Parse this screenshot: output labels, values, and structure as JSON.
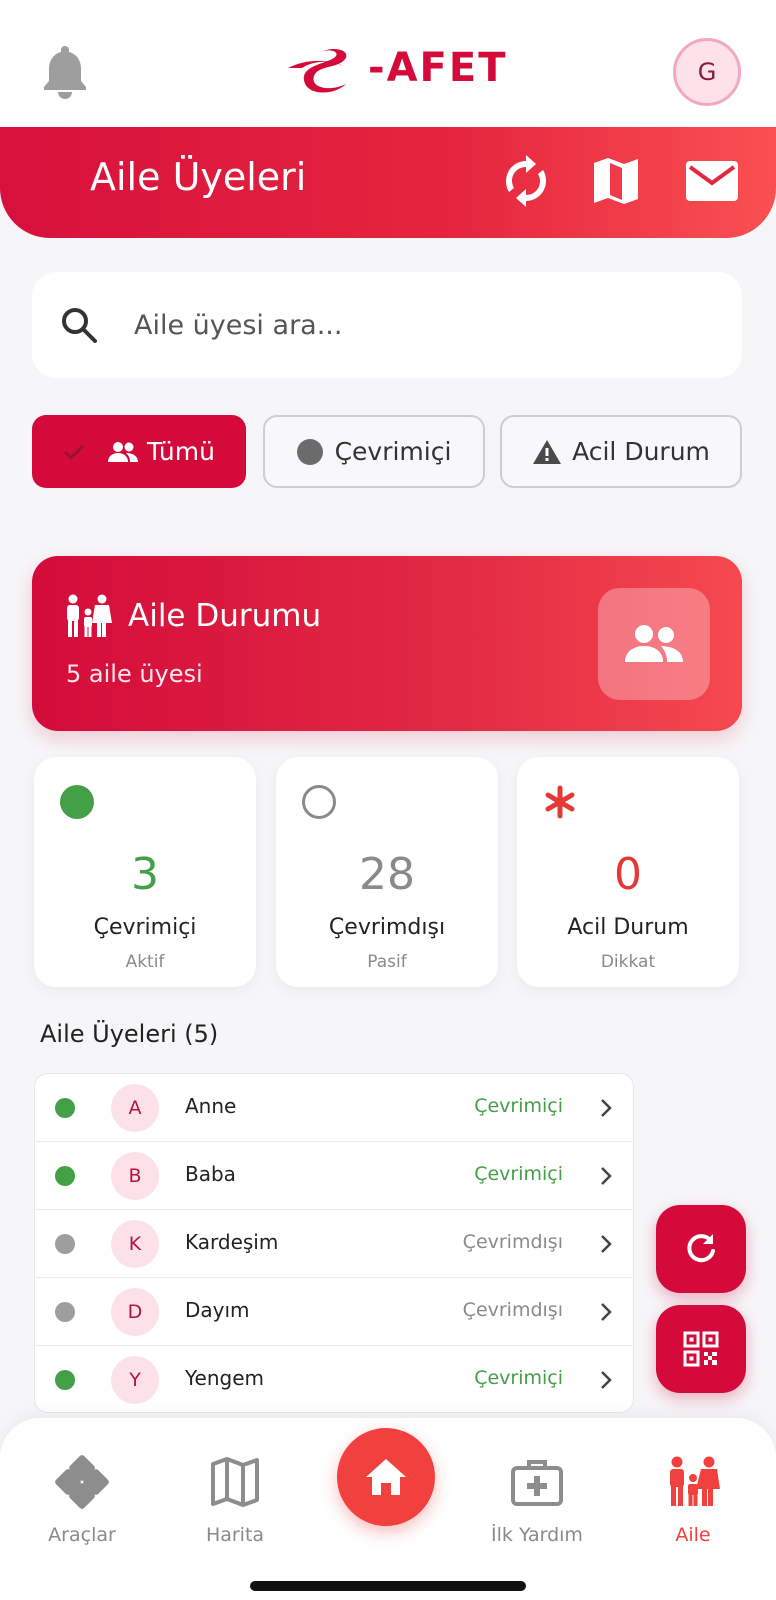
{
  "app": {
    "logo_text": "-AFET",
    "avatar_initial": "G"
  },
  "header": {
    "title": "Aile Üyeleri"
  },
  "search": {
    "placeholder": "Aile üyesi ara..."
  },
  "filters": [
    {
      "label": "Tümü",
      "active": true
    },
    {
      "label": "Çevrimiçi",
      "active": false
    },
    {
      "label": "Acil Durum",
      "active": false
    }
  ],
  "family_status": {
    "title": "Aile Durumu",
    "subtitle": "5 aile üyesi"
  },
  "stats": [
    {
      "value": "3",
      "label": "Çevrimiçi",
      "sub": "Aktif",
      "color": "#43a047"
    },
    {
      "value": "28",
      "label": "Çevrimdışı",
      "sub": "Pasif",
      "color": "#8a8a8a"
    },
    {
      "value": "0",
      "label": "Acil Durum",
      "sub": "Dikkat",
      "color": "#e53935"
    }
  ],
  "members_section": {
    "title": "Aile Üyeleri (5)"
  },
  "members": [
    {
      "initial": "A",
      "name": "Anne",
      "status": "Çevrimiçi",
      "online": true
    },
    {
      "initial": "B",
      "name": "Baba",
      "status": "Çevrimiçi",
      "online": true
    },
    {
      "initial": "K",
      "name": "Kardeşim",
      "status": "Çevrimdışı",
      "online": false
    },
    {
      "initial": "D",
      "name": "Dayım",
      "status": "Çevrimdışı",
      "online": false
    },
    {
      "initial": "Y",
      "name": "Yengem",
      "status": "Çevrimiçi",
      "online": true
    }
  ],
  "bottom_nav": [
    {
      "label": "Araçlar",
      "icon": "tools-icon"
    },
    {
      "label": "Harita",
      "icon": "map-icon"
    },
    {
      "label": "İlk Yardım",
      "icon": "first-aid-icon"
    },
    {
      "label": "Aile",
      "icon": "family-icon",
      "active": true
    }
  ],
  "colors": {
    "primary": "#d40b3a",
    "online": "#43a047",
    "offline": "#9e9e9e",
    "alert": "#e53935"
  }
}
